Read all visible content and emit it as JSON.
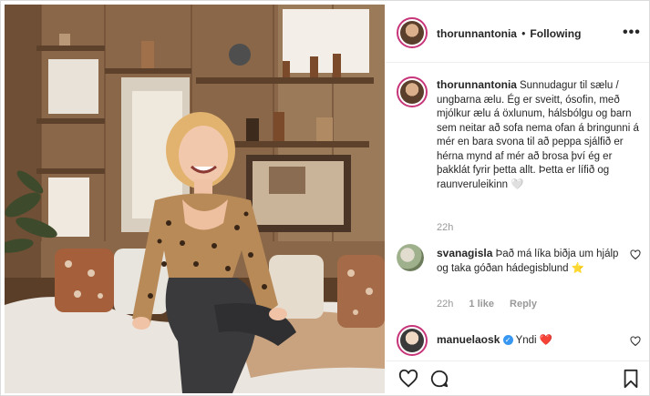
{
  "header": {
    "username": "thorunnantonia",
    "separator": "•",
    "follow_status": "Following",
    "more_icon": "more-options-icon"
  },
  "caption": {
    "username": "thorunnantonia",
    "text": "Sunnudagur til sælu / ungbarna ælu. Ég er sveitt, ósofin, með mjólkur ælu á öxlunum, hálsbólgu og barn sem neitar að sofa nema ofan á bringunni á mér en bara svona til að peppa sjálfið er hérna mynd af mér að brosa því ég er þakklát fyrir þetta allt. Þetta er lífið og raunveruleikinn 🤍",
    "time": "22h"
  },
  "comments": [
    {
      "username": "svanagisla",
      "text": "Það má líka biðja um hjálp og taka góðan hádegisblund ⭐",
      "time": "22h",
      "likes": "1 like",
      "reply": "Reply"
    },
    {
      "username": "manuelaosk",
      "verified": true,
      "text": "Yndi ❤️"
    }
  ],
  "icons": {
    "like": "heart-outline-icon",
    "comment": "comment-bubble-icon",
    "save": "bookmark-icon"
  },
  "colors": {
    "story_ring": "#c7367a",
    "verified_badge": "#3897f0",
    "heart_red": "#ed4956",
    "muted_text": "#999999"
  }
}
